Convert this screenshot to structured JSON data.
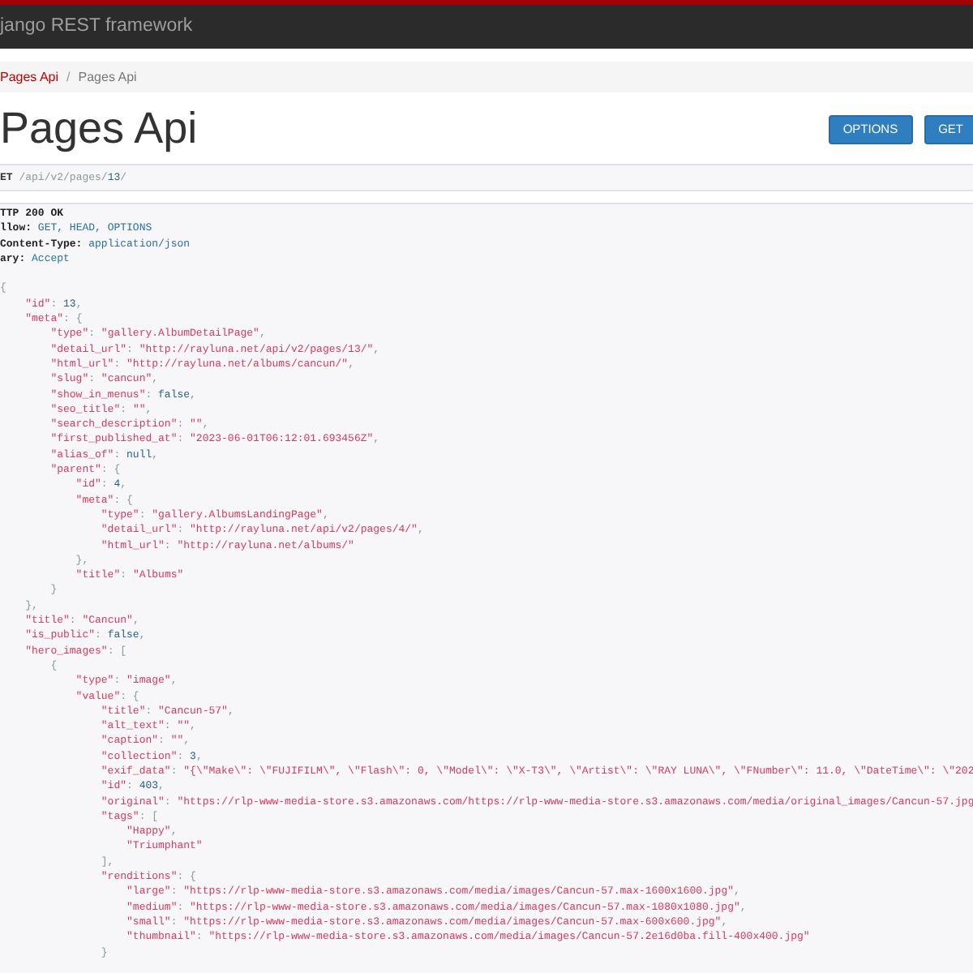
{
  "navbar": {
    "brand": "jango REST framework"
  },
  "breadcrumbs": [
    {
      "label": "Pages Api",
      "active": false
    },
    {
      "separator": "/",
      "label": "Pages Api",
      "active": true
    }
  ],
  "page_title": "Pages Api",
  "buttons": [
    "OPTIONS",
    "GET"
  ],
  "request": [
    {
      "kind": "method",
      "text": "ET"
    },
    {
      "kind": "p",
      "text": " /api/v2/pages/"
    },
    {
      "kind": "n",
      "text": "13"
    },
    {
      "kind": "p",
      "text": "/"
    }
  ],
  "response": {
    "status": "TTP 200 OK",
    "headers": [
      {
        "name": "llow:",
        "value": "GET, HEAD, OPTIONS"
      },
      {
        "name": "Content-Type:",
        "value": "application/json"
      },
      {
        "name": "ary:",
        "value": "Accept"
      }
    ],
    "body": [
      [
        {
          "kind": "p",
          "text": "{"
        }
      ],
      [
        {
          "kind": "s",
          "text": "    \"id\""
        },
        {
          "kind": "p",
          "text": ": "
        },
        {
          "kind": "n",
          "text": "13"
        },
        {
          "kind": "p",
          "text": ","
        }
      ],
      [
        {
          "kind": "s",
          "text": "    \"meta\""
        },
        {
          "kind": "p",
          "text": ": {"
        }
      ],
      [
        {
          "kind": "s",
          "text": "        \"type\""
        },
        {
          "kind": "p",
          "text": ": "
        },
        {
          "kind": "s",
          "text": "\"gallery.AlbumDetailPage\""
        },
        {
          "kind": "p",
          "text": ","
        }
      ],
      [
        {
          "kind": "s",
          "text": "        \"detail_url\""
        },
        {
          "kind": "p",
          "text": ": "
        },
        {
          "kind": "s",
          "text": "\"http://rayluna.net/api/v2/pages/13/\""
        },
        {
          "kind": "p",
          "text": ","
        }
      ],
      [
        {
          "kind": "s",
          "text": "        \"html_url\""
        },
        {
          "kind": "p",
          "text": ": "
        },
        {
          "kind": "s",
          "text": "\"http://rayluna.net/albums/cancun/\""
        },
        {
          "kind": "p",
          "text": ","
        }
      ],
      [
        {
          "kind": "s",
          "text": "        \"slug\""
        },
        {
          "kind": "p",
          "text": ": "
        },
        {
          "kind": "s",
          "text": "\"cancun\""
        },
        {
          "kind": "p",
          "text": ","
        }
      ],
      [
        {
          "kind": "s",
          "text": "        \"show_in_menus\""
        },
        {
          "kind": "p",
          "text": ": "
        },
        {
          "kind": "n",
          "text": "false"
        },
        {
          "kind": "p",
          "text": ","
        }
      ],
      [
        {
          "kind": "s",
          "text": "        \"seo_title\""
        },
        {
          "kind": "p",
          "text": ": "
        },
        {
          "kind": "s",
          "text": "\"\""
        },
        {
          "kind": "p",
          "text": ","
        }
      ],
      [
        {
          "kind": "s",
          "text": "        \"search_description\""
        },
        {
          "kind": "p",
          "text": ": "
        },
        {
          "kind": "s",
          "text": "\"\""
        },
        {
          "kind": "p",
          "text": ","
        }
      ],
      [
        {
          "kind": "s",
          "text": "        \"first_published_at\""
        },
        {
          "kind": "p",
          "text": ": "
        },
        {
          "kind": "s",
          "text": "\"2023-06-01T06:12:01.693456Z\""
        },
        {
          "kind": "p",
          "text": ","
        }
      ],
      [
        {
          "kind": "s",
          "text": "        \"alias_of\""
        },
        {
          "kind": "p",
          "text": ": "
        },
        {
          "kind": "n",
          "text": "null"
        },
        {
          "kind": "p",
          "text": ","
        }
      ],
      [
        {
          "kind": "s",
          "text": "        \"parent\""
        },
        {
          "kind": "p",
          "text": ": {"
        }
      ],
      [
        {
          "kind": "s",
          "text": "            \"id\""
        },
        {
          "kind": "p",
          "text": ": "
        },
        {
          "kind": "n",
          "text": "4"
        },
        {
          "kind": "p",
          "text": ","
        }
      ],
      [
        {
          "kind": "s",
          "text": "            \"meta\""
        },
        {
          "kind": "p",
          "text": ": {"
        }
      ],
      [
        {
          "kind": "s",
          "text": "                \"type\""
        },
        {
          "kind": "p",
          "text": ": "
        },
        {
          "kind": "s",
          "text": "\"gallery.AlbumsLandingPage\""
        },
        {
          "kind": "p",
          "text": ","
        }
      ],
      [
        {
          "kind": "s",
          "text": "                \"detail_url\""
        },
        {
          "kind": "p",
          "text": ": "
        },
        {
          "kind": "s",
          "text": "\"http://rayluna.net/api/v2/pages/4/\""
        },
        {
          "kind": "p",
          "text": ","
        }
      ],
      [
        {
          "kind": "s",
          "text": "                \"html_url\""
        },
        {
          "kind": "p",
          "text": ": "
        },
        {
          "kind": "s",
          "text": "\"http://rayluna.net/albums/\""
        }
      ],
      [
        {
          "kind": "p",
          "text": "            },"
        }
      ],
      [
        {
          "kind": "s",
          "text": "            \"title\""
        },
        {
          "kind": "p",
          "text": ": "
        },
        {
          "kind": "s",
          "text": "\"Albums\""
        }
      ],
      [
        {
          "kind": "p",
          "text": "        }"
        }
      ],
      [
        {
          "kind": "p",
          "text": "    },"
        }
      ],
      [
        {
          "kind": "s",
          "text": "    \"title\""
        },
        {
          "kind": "p",
          "text": ": "
        },
        {
          "kind": "s",
          "text": "\"Cancun\""
        },
        {
          "kind": "p",
          "text": ","
        }
      ],
      [
        {
          "kind": "s",
          "text": "    \"is_public\""
        },
        {
          "kind": "p",
          "text": ": "
        },
        {
          "kind": "n",
          "text": "false"
        },
        {
          "kind": "p",
          "text": ","
        }
      ],
      [
        {
          "kind": "s",
          "text": "    \"hero_images\""
        },
        {
          "kind": "p",
          "text": ": ["
        }
      ],
      [
        {
          "kind": "p",
          "text": "        {"
        }
      ],
      [
        {
          "kind": "s",
          "text": "            \"type\""
        },
        {
          "kind": "p",
          "text": ": "
        },
        {
          "kind": "s",
          "text": "\"image\""
        },
        {
          "kind": "p",
          "text": ","
        }
      ],
      [
        {
          "kind": "s",
          "text": "            \"value\""
        },
        {
          "kind": "p",
          "text": ": {"
        }
      ],
      [
        {
          "kind": "s",
          "text": "                \"title\""
        },
        {
          "kind": "p",
          "text": ": "
        },
        {
          "kind": "s",
          "text": "\"Cancun-57\""
        },
        {
          "kind": "p",
          "text": ","
        }
      ],
      [
        {
          "kind": "s",
          "text": "                \"alt_text\""
        },
        {
          "kind": "p",
          "text": ": "
        },
        {
          "kind": "s",
          "text": "\"\""
        },
        {
          "kind": "p",
          "text": ","
        }
      ],
      [
        {
          "kind": "s",
          "text": "                \"caption\""
        },
        {
          "kind": "p",
          "text": ": "
        },
        {
          "kind": "s",
          "text": "\"\""
        },
        {
          "kind": "p",
          "text": ","
        }
      ],
      [
        {
          "kind": "s",
          "text": "                \"collection\""
        },
        {
          "kind": "p",
          "text": ": "
        },
        {
          "kind": "n",
          "text": "3"
        },
        {
          "kind": "p",
          "text": ","
        }
      ],
      [
        {
          "kind": "s",
          "text": "                \"exif_data\""
        },
        {
          "kind": "p",
          "text": ": "
        },
        {
          "kind": "s",
          "text": "\"{\\\"Make\\\": \\\"FUJIFILM\\\", \\\"Flash\\\": 0, \\\"Model\\\": \\\"X-T3\\\", \\\"Artist\\\": \\\"RAY LUNA\\\", \\\"FNumber\\\": 11.0, \\\"DateTime\\\": \\\"202"
        }
      ],
      [
        {
          "kind": "s",
          "text": "                \"id\""
        },
        {
          "kind": "p",
          "text": ": "
        },
        {
          "kind": "n",
          "text": "403"
        },
        {
          "kind": "p",
          "text": ","
        }
      ],
      [
        {
          "kind": "s",
          "text": "                \"original\""
        },
        {
          "kind": "p",
          "text": ": "
        },
        {
          "kind": "s",
          "text": "\"https://rlp-www-media-store.s3.amazonaws.com/https://rlp-www-media-store.s3.amazonaws.com/media/original_images/Cancun-57.jpg"
        }
      ],
      [
        {
          "kind": "s",
          "text": "                \"tags\""
        },
        {
          "kind": "p",
          "text": ": ["
        }
      ],
      [
        {
          "kind": "s",
          "text": "                    \"Happy\""
        },
        {
          "kind": "p",
          "text": ","
        }
      ],
      [
        {
          "kind": "s",
          "text": "                    \"Triumphant\""
        }
      ],
      [
        {
          "kind": "p",
          "text": "                ],"
        }
      ],
      [
        {
          "kind": "s",
          "text": "                \"renditions\""
        },
        {
          "kind": "p",
          "text": ": {"
        }
      ],
      [
        {
          "kind": "s",
          "text": "                    \"large\""
        },
        {
          "kind": "p",
          "text": ": "
        },
        {
          "kind": "s",
          "text": "\"https://rlp-www-media-store.s3.amazonaws.com/media/images/Cancun-57.max-1600x1600.jpg\""
        },
        {
          "kind": "p",
          "text": ","
        }
      ],
      [
        {
          "kind": "s",
          "text": "                    \"medium\""
        },
        {
          "kind": "p",
          "text": ": "
        },
        {
          "kind": "s",
          "text": "\"https://rlp-www-media-store.s3.amazonaws.com/media/images/Cancun-57.max-1080x1080.jpg\""
        },
        {
          "kind": "p",
          "text": ","
        }
      ],
      [
        {
          "kind": "s",
          "text": "                    \"small\""
        },
        {
          "kind": "p",
          "text": ": "
        },
        {
          "kind": "s",
          "text": "\"https://rlp-www-media-store.s3.amazonaws.com/media/images/Cancun-57.max-600x600.jpg\""
        },
        {
          "kind": "p",
          "text": ","
        }
      ],
      [
        {
          "kind": "s",
          "text": "                    \"thumbnail\""
        },
        {
          "kind": "p",
          "text": ": "
        },
        {
          "kind": "s",
          "text": "\"https://rlp-www-media-store.s3.amazonaws.com/media/images/Cancun-57.2e16d0ba.fill-400x400.jpg\""
        }
      ],
      [
        {
          "kind": "p",
          "text": "                }"
        }
      ]
    ]
  }
}
